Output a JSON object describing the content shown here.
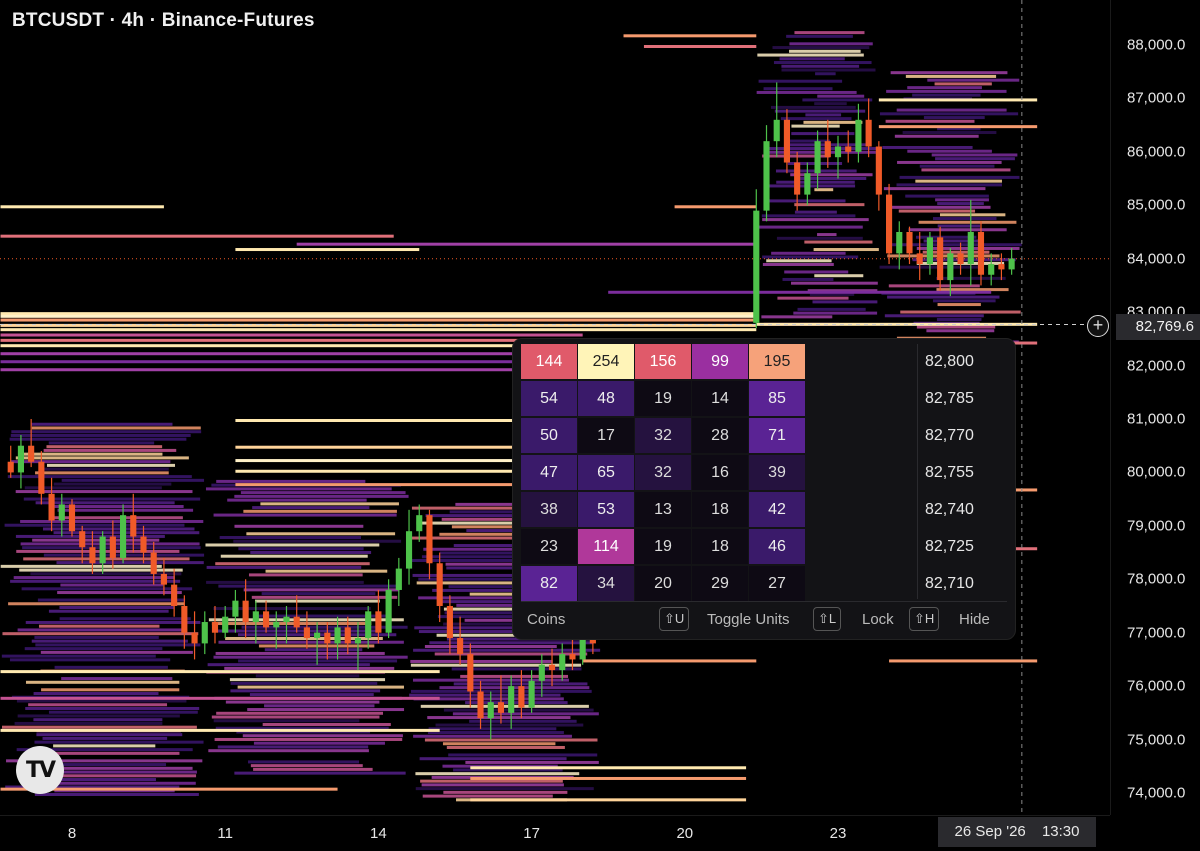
{
  "title": "BTCUSDT · 4h · Binance-Futures",
  "price_label": "82,769.6",
  "date_label": {
    "date": "26 Sep '26",
    "time": "13:30"
  },
  "colors": {
    "up": "#4ec24a",
    "down": "#f05a28",
    "heat_low": "#3a1a66",
    "heat_mid": "#a34ab0",
    "heat_high": "#ffe9b0"
  },
  "chart_data": {
    "type": "heatmap",
    "title": "BTCUSDT · 4h · Binance-Futures",
    "y_ticks": [
      "88,000.0",
      "87,000.0",
      "86,000.0",
      "85,000.0",
      "84,000.0",
      "83,000.0",
      "82,000.0",
      "81,000.0",
      "80,000.0",
      "79,000.0",
      "78,000.0",
      "77,000.0",
      "76,000.0",
      "75,000.0",
      "74,000.0"
    ],
    "y_tick_values": [
      88000,
      87000,
      86000,
      85000,
      84000,
      83000,
      82000,
      81000,
      80000,
      79000,
      78000,
      77000,
      76000,
      75000,
      74000
    ],
    "x_ticks": [
      "8",
      "11",
      "14",
      "17",
      "20",
      "23"
    ],
    "x_tick_days": [
      8,
      11,
      14,
      17,
      20,
      23
    ],
    "ylim": [
      73700,
      88700
    ],
    "xlim": [
      6.6,
      27.2
    ],
    "current_price": 82769.6,
    "current_price_line": 84000,
    "candles": [
      {
        "d": 6.8,
        "o": 80200,
        "h": 80500,
        "l": 79900,
        "c": 80000
      },
      {
        "d": 7.0,
        "o": 80000,
        "h": 80700,
        "l": 79700,
        "c": 80500
      },
      {
        "d": 7.2,
        "o": 80500,
        "h": 81000,
        "l": 80100,
        "c": 80200
      },
      {
        "d": 7.4,
        "o": 80200,
        "h": 80400,
        "l": 79400,
        "c": 79600
      },
      {
        "d": 7.6,
        "o": 79600,
        "h": 79900,
        "l": 78900,
        "c": 79100
      },
      {
        "d": 7.8,
        "o": 79100,
        "h": 79600,
        "l": 78800,
        "c": 79400
      },
      {
        "d": 8.0,
        "o": 79400,
        "h": 79500,
        "l": 78800,
        "c": 78900
      },
      {
        "d": 8.2,
        "o": 78900,
        "h": 79000,
        "l": 78300,
        "c": 78600
      },
      {
        "d": 8.4,
        "o": 78600,
        "h": 78900,
        "l": 78100,
        "c": 78300
      },
      {
        "d": 8.6,
        "o": 78300,
        "h": 78900,
        "l": 78100,
        "c": 78800
      },
      {
        "d": 8.8,
        "o": 78800,
        "h": 79100,
        "l": 78200,
        "c": 78400
      },
      {
        "d": 9.0,
        "o": 78400,
        "h": 79400,
        "l": 78300,
        "c": 79200
      },
      {
        "d": 9.2,
        "o": 79200,
        "h": 79600,
        "l": 78500,
        "c": 78800
      },
      {
        "d": 9.4,
        "o": 78800,
        "h": 79000,
        "l": 78300,
        "c": 78500
      },
      {
        "d": 9.6,
        "o": 78500,
        "h": 78700,
        "l": 77900,
        "c": 78100
      },
      {
        "d": 9.8,
        "o": 78100,
        "h": 78400,
        "l": 77700,
        "c": 77900
      },
      {
        "d": 10.0,
        "o": 77900,
        "h": 78200,
        "l": 77300,
        "c": 77500
      },
      {
        "d": 10.2,
        "o": 77500,
        "h": 77700,
        "l": 76700,
        "c": 77000
      },
      {
        "d": 10.4,
        "o": 77000,
        "h": 77400,
        "l": 76500,
        "c": 76800
      },
      {
        "d": 10.6,
        "o": 76800,
        "h": 77400,
        "l": 76600,
        "c": 77200
      },
      {
        "d": 10.8,
        "o": 77200,
        "h": 77500,
        "l": 76800,
        "c": 77000
      },
      {
        "d": 11.0,
        "o": 77000,
        "h": 77500,
        "l": 76900,
        "c": 77300
      },
      {
        "d": 11.2,
        "o": 77300,
        "h": 77800,
        "l": 77000,
        "c": 77600
      },
      {
        "d": 11.4,
        "o": 77600,
        "h": 78000,
        "l": 76900,
        "c": 77200
      },
      {
        "d": 11.6,
        "o": 77200,
        "h": 77600,
        "l": 76800,
        "c": 77400
      },
      {
        "d": 11.8,
        "o": 77400,
        "h": 77600,
        "l": 77000,
        "c": 77100
      },
      {
        "d": 12.0,
        "o": 77100,
        "h": 77400,
        "l": 76700,
        "c": 77200
      },
      {
        "d": 12.2,
        "o": 77200,
        "h": 77500,
        "l": 76800,
        "c": 77300
      },
      {
        "d": 12.4,
        "o": 77300,
        "h": 77700,
        "l": 77000,
        "c": 77100
      },
      {
        "d": 12.6,
        "o": 77100,
        "h": 77400,
        "l": 76700,
        "c": 76900
      },
      {
        "d": 12.8,
        "o": 76900,
        "h": 77200,
        "l": 76400,
        "c": 77000
      },
      {
        "d": 13.0,
        "o": 77000,
        "h": 77200,
        "l": 76500,
        "c": 76800
      },
      {
        "d": 13.2,
        "o": 76800,
        "h": 77300,
        "l": 76500,
        "c": 77100
      },
      {
        "d": 13.4,
        "o": 77100,
        "h": 77300,
        "l": 76600,
        "c": 76800
      },
      {
        "d": 13.6,
        "o": 76800,
        "h": 77200,
        "l": 76300,
        "c": 76900
      },
      {
        "d": 13.8,
        "o": 76900,
        "h": 77500,
        "l": 76700,
        "c": 77400
      },
      {
        "d": 14.0,
        "o": 77400,
        "h": 77800,
        "l": 76800,
        "c": 77000
      },
      {
        "d": 14.2,
        "o": 77000,
        "h": 78000,
        "l": 76900,
        "c": 77800
      },
      {
        "d": 14.4,
        "o": 77800,
        "h": 78400,
        "l": 77500,
        "c": 78200
      },
      {
        "d": 14.6,
        "o": 78200,
        "h": 79300,
        "l": 77900,
        "c": 78900
      },
      {
        "d": 14.8,
        "o": 78900,
        "h": 79400,
        "l": 78700,
        "c": 79200
      },
      {
        "d": 15.0,
        "o": 79200,
        "h": 79300,
        "l": 78000,
        "c": 78300
      },
      {
        "d": 15.2,
        "o": 78300,
        "h": 78500,
        "l": 77200,
        "c": 77500
      },
      {
        "d": 15.4,
        "o": 77500,
        "h": 77700,
        "l": 76600,
        "c": 76900
      },
      {
        "d": 15.6,
        "o": 76900,
        "h": 77300,
        "l": 76400,
        "c": 76600
      },
      {
        "d": 15.8,
        "o": 76600,
        "h": 76800,
        "l": 75600,
        "c": 75900
      },
      {
        "d": 16.0,
        "o": 75900,
        "h": 76100,
        "l": 75200,
        "c": 75400
      },
      {
        "d": 16.2,
        "o": 75400,
        "h": 75900,
        "l": 75000,
        "c": 75700
      },
      {
        "d": 16.4,
        "o": 75700,
        "h": 76200,
        "l": 75300,
        "c": 75500
      },
      {
        "d": 16.6,
        "o": 75500,
        "h": 76200,
        "l": 75200,
        "c": 76000
      },
      {
        "d": 16.8,
        "o": 76000,
        "h": 76300,
        "l": 75400,
        "c": 75600
      },
      {
        "d": 17.0,
        "o": 75600,
        "h": 76300,
        "l": 75500,
        "c": 76100
      },
      {
        "d": 17.2,
        "o": 76100,
        "h": 76600,
        "l": 75800,
        "c": 76400
      },
      {
        "d": 17.4,
        "o": 76400,
        "h": 76700,
        "l": 76000,
        "c": 76300
      },
      {
        "d": 17.6,
        "o": 76300,
        "h": 76800,
        "l": 76100,
        "c": 76600
      },
      {
        "d": 17.8,
        "o": 76600,
        "h": 77000,
        "l": 76300,
        "c": 76500
      },
      {
        "d": 18.0,
        "o": 76500,
        "h": 77100,
        "l": 76400,
        "c": 77000
      },
      {
        "d": 18.2,
        "o": 77000,
        "h": 77200,
        "l": 76600,
        "c": 76800
      },
      {
        "d": 21.4,
        "o": 82800,
        "h": 85300,
        "l": 82700,
        "c": 84900
      },
      {
        "d": 21.6,
        "o": 84900,
        "h": 86500,
        "l": 84700,
        "c": 86200
      },
      {
        "d": 21.8,
        "o": 86200,
        "h": 87300,
        "l": 85900,
        "c": 86600
      },
      {
        "d": 22.0,
        "o": 86600,
        "h": 86800,
        "l": 85600,
        "c": 85800
      },
      {
        "d": 22.2,
        "o": 85800,
        "h": 86000,
        "l": 84900,
        "c": 85200
      },
      {
        "d": 22.4,
        "o": 85200,
        "h": 85800,
        "l": 85000,
        "c": 85600
      },
      {
        "d": 22.6,
        "o": 85600,
        "h": 86400,
        "l": 85300,
        "c": 86200
      },
      {
        "d": 22.8,
        "o": 86200,
        "h": 86600,
        "l": 85700,
        "c": 85900
      },
      {
        "d": 23.0,
        "o": 85900,
        "h": 86300,
        "l": 85500,
        "c": 86100
      },
      {
        "d": 23.2,
        "o": 86100,
        "h": 86400,
        "l": 85800,
        "c": 86000
      },
      {
        "d": 23.4,
        "o": 86000,
        "h": 86900,
        "l": 85800,
        "c": 86600
      },
      {
        "d": 23.6,
        "o": 86600,
        "h": 87000,
        "l": 85900,
        "c": 86100
      },
      {
        "d": 23.8,
        "o": 86100,
        "h": 86200,
        "l": 84900,
        "c": 85200
      },
      {
        "d": 24.0,
        "o": 85200,
        "h": 85400,
        "l": 83900,
        "c": 84100
      },
      {
        "d": 24.2,
        "o": 84100,
        "h": 84700,
        "l": 83800,
        "c": 84500
      },
      {
        "d": 24.4,
        "o": 84500,
        "h": 84600,
        "l": 83900,
        "c": 84100
      },
      {
        "d": 24.6,
        "o": 84100,
        "h": 84500,
        "l": 83600,
        "c": 83900
      },
      {
        "d": 24.8,
        "o": 83900,
        "h": 84500,
        "l": 83700,
        "c": 84400
      },
      {
        "d": 25.0,
        "o": 84400,
        "h": 84600,
        "l": 83400,
        "c": 83600
      },
      {
        "d": 25.2,
        "o": 83600,
        "h": 84200,
        "l": 83300,
        "c": 84100
      },
      {
        "d": 25.4,
        "o": 84100,
        "h": 84300,
        "l": 83700,
        "c": 83900
      },
      {
        "d": 25.6,
        "o": 83900,
        "h": 85100,
        "l": 83500,
        "c": 84500
      },
      {
        "d": 25.8,
        "o": 84500,
        "h": 84700,
        "l": 83500,
        "c": 83700
      },
      {
        "d": 26.0,
        "o": 83700,
        "h": 84100,
        "l": 83500,
        "c": 83900
      },
      {
        "d": 26.2,
        "o": 83900,
        "h": 84100,
        "l": 83600,
        "c": 83800
      },
      {
        "d": 26.4,
        "o": 83800,
        "h": 84200,
        "l": 83700,
        "c": 84000
      }
    ],
    "tooltip": {
      "rows": [
        {
          "price": "82,800",
          "values": [
            144,
            254,
            156,
            99,
            195
          ]
        },
        {
          "price": "82,785",
          "values": [
            54,
            48,
            19,
            14,
            85
          ]
        },
        {
          "price": "82,770",
          "values": [
            50,
            17,
            32,
            28,
            71
          ]
        },
        {
          "price": "82,755",
          "values": [
            47,
            65,
            32,
            16,
            39
          ]
        },
        {
          "price": "82,740",
          "values": [
            38,
            53,
            13,
            18,
            42
          ]
        },
        {
          "price": "82,725",
          "values": [
            23,
            114,
            19,
            18,
            46
          ]
        },
        {
          "price": "82,710",
          "values": [
            82,
            34,
            20,
            29,
            27
          ]
        }
      ],
      "footer": {
        "units": "Coins",
        "toggle_key": "⇧U",
        "toggle_label": "Toggle Units",
        "lock_key": "⇧L",
        "lock_label": "Lock",
        "hide_key": "⇧H",
        "hide_label": "Hide"
      }
    }
  }
}
